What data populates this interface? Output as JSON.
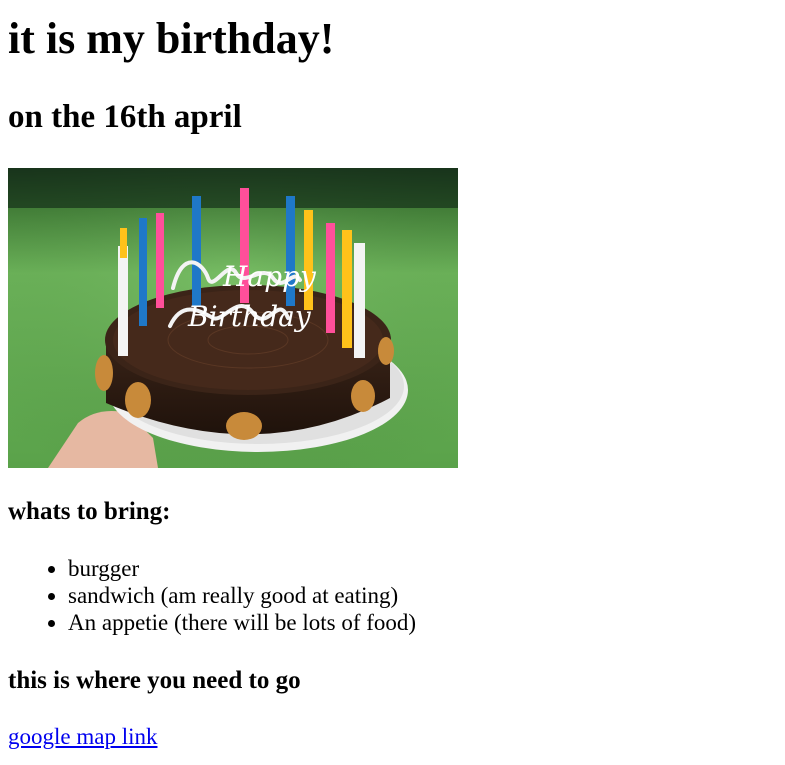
{
  "page": {
    "title": "it is my birthday!",
    "subtitle": "on the 16th april"
  },
  "image": {
    "icon": "birthday-cake-photo",
    "lettering": "Happy Birthday",
    "colors": {
      "background_green": "#6aa84f",
      "chocolate": "#3b2418",
      "plate": "#f2f2f2",
      "candle_pink": "#ff4f9a",
      "candle_blue": "#1f78c8",
      "candle_yellow": "#ffc21a",
      "candle_white": "#f4f4f4"
    }
  },
  "bring": {
    "heading": "whats to bring:",
    "items": [
      "burgger",
      "sandwich (am really good at eating)",
      "An appetie (there will be lots of food)"
    ]
  },
  "directions": {
    "heading": "this is where you need to go",
    "link_text": "google map link"
  }
}
